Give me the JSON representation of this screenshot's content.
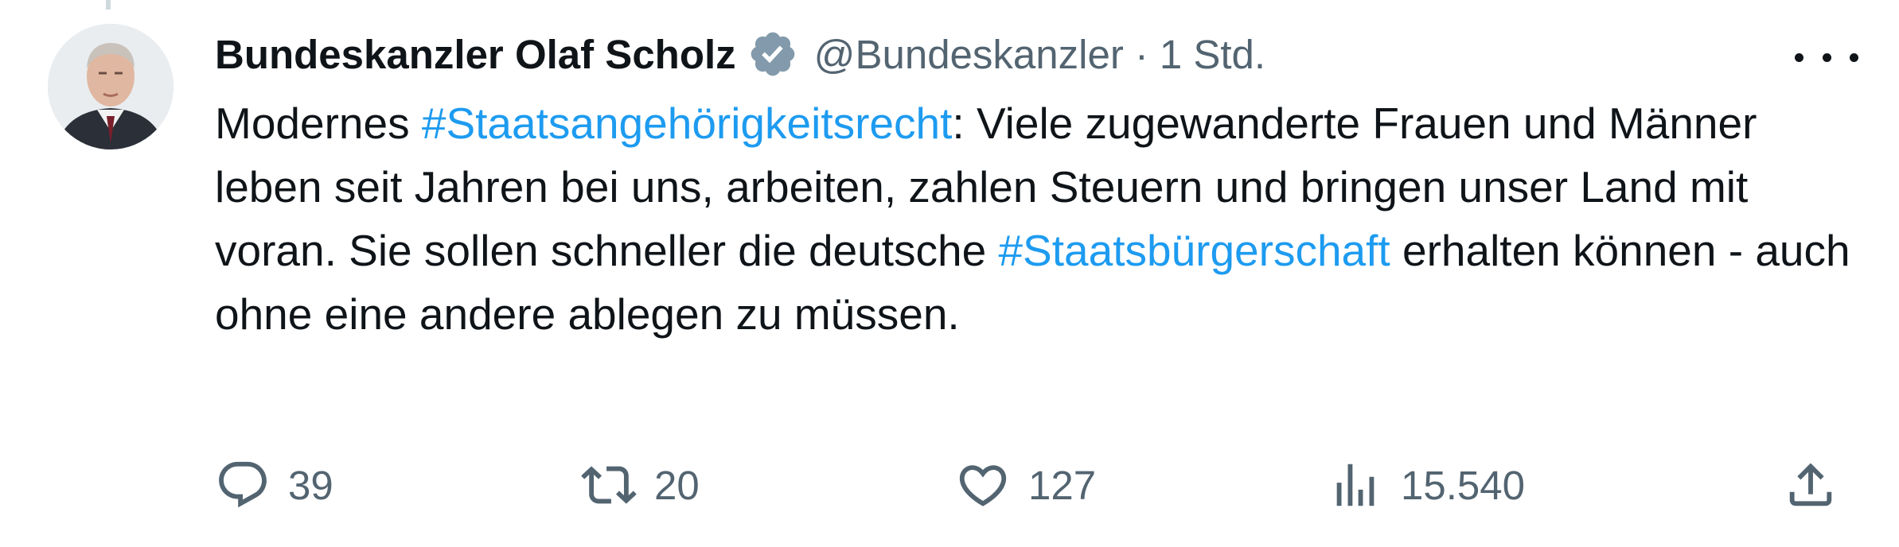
{
  "author": {
    "display_name": "Bundeskanzler Olaf Scholz",
    "handle": "@Bundeskanzler",
    "separator": "·",
    "time": "1 Std.",
    "verified": true
  },
  "tweet": {
    "segments": [
      {
        "text": "Modernes ",
        "type": "text"
      },
      {
        "text": "#Staatsangehörigkeitsrecht",
        "type": "hashtag"
      },
      {
        "text": ": Viele zugewanderte Frauen und Männer leben seit Jahren bei uns, arbeiten, zahlen Steuern und bringen unser Land mit voran. Sie sollen schneller die deutsche ",
        "type": "text"
      },
      {
        "text": "#Staatsbürgerschaft",
        "type": "hashtag"
      },
      {
        "text": " erhalten können - auch ohne eine andere ablegen zu müssen.",
        "type": "text"
      }
    ]
  },
  "actions": {
    "reply": {
      "count": "39",
      "icon": "reply-icon"
    },
    "retweet": {
      "count": "20",
      "icon": "retweet-icon"
    },
    "like": {
      "count": "127",
      "icon": "heart-icon"
    },
    "views": {
      "count": "15.540",
      "icon": "views-icon"
    },
    "share": {
      "icon": "share-icon"
    }
  },
  "colors": {
    "text": "#0f1419",
    "secondary": "#536471",
    "link": "#1d9bf0",
    "verified_badge": "#829aab"
  }
}
